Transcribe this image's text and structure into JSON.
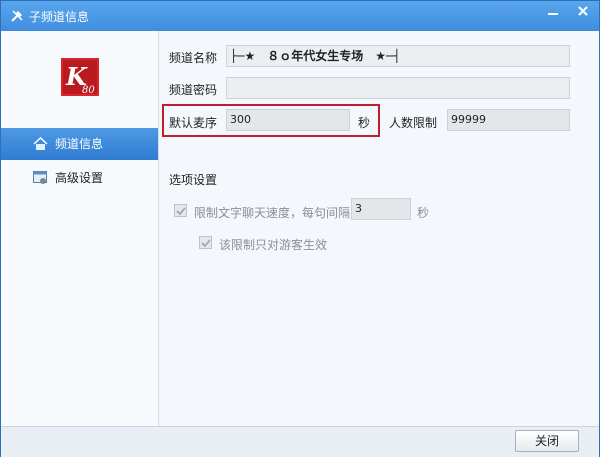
{
  "window": {
    "title": "子频道信息",
    "controls": [
      "minimize",
      "close"
    ]
  },
  "sidebar": {
    "logo_text": "K80",
    "items": [
      {
        "label": "频道信息",
        "icon": "house-icon",
        "active": true
      },
      {
        "label": "高级设置",
        "icon": "settings-window-icon",
        "active": false
      }
    ]
  },
  "form": {
    "channel_name_label": "频道名称",
    "channel_name_value": "├─★　８ｏ年代女生专场　★─┤",
    "channel_password_label": "频道密码",
    "channel_password_value": "",
    "default_mic_order_label": "默认麦序",
    "default_mic_order_value": "300",
    "seconds_unit": "秒",
    "user_limit_label": "人数限制",
    "user_limit_value": "99999"
  },
  "options": {
    "section_title": "选项设置",
    "limit_chat_speed_label": "限制文字聊天速度，每句间隔",
    "limit_chat_speed_value": "3",
    "limit_chat_speed_unit": "秒",
    "limit_chat_speed_checked": true,
    "guest_only_label": "该限制只对游客生效",
    "guest_only_checked": true
  },
  "footer": {
    "close_label": "关闭"
  },
  "colors": {
    "titlebar": "#3f8ddd",
    "active_nav": "#2f7cd2",
    "highlight": "#c01f2c"
  }
}
